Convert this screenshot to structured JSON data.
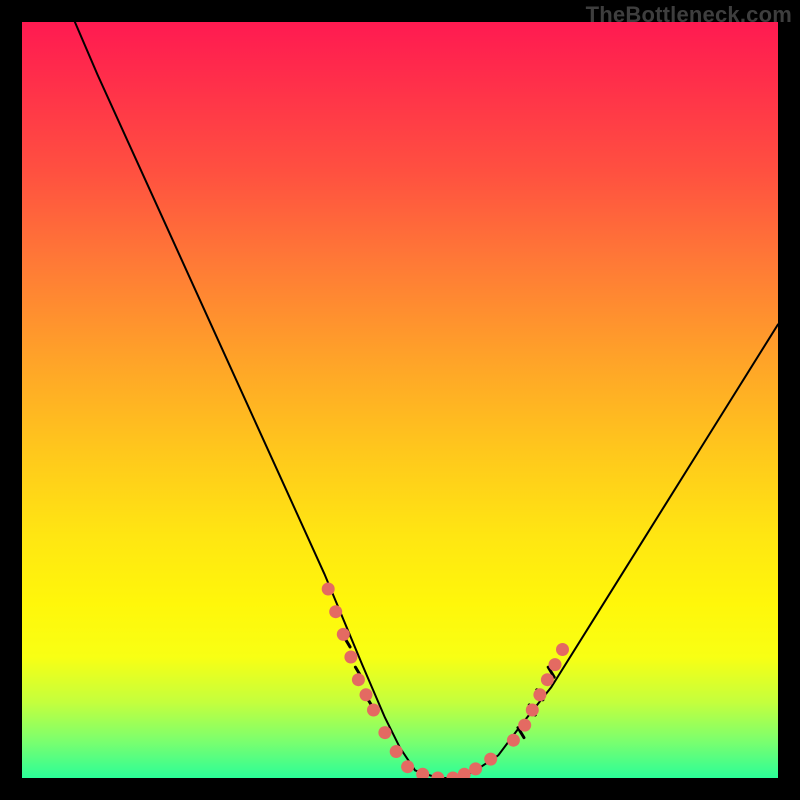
{
  "watermark": "TheBottleneck.com",
  "colors": {
    "dot": "#e46a62",
    "curve": "#000000",
    "gradient_top": "#ff1a51",
    "gradient_bottom": "#2bfd98"
  },
  "chart_data": {
    "type": "line",
    "title": "",
    "xlabel": "",
    "ylabel": "",
    "xlim": [
      0,
      100
    ],
    "ylim": [
      0,
      100
    ],
    "grid": false,
    "series": [
      {
        "name": "bottleneck-curve",
        "x": [
          7,
          10,
          15,
          20,
          25,
          30,
          35,
          40,
          45,
          48,
          50,
          52,
          55,
          58,
          60,
          63,
          66,
          70,
          75,
          80,
          85,
          90,
          95,
          100
        ],
        "y": [
          100,
          93,
          82,
          71,
          60,
          49,
          38,
          27,
          15,
          8,
          4,
          1,
          0,
          0,
          1,
          3,
          7,
          12,
          20,
          28,
          36,
          44,
          52,
          60
        ]
      }
    ],
    "markers": {
      "name": "highlight-dots",
      "note": "approximate salmon-colored data-point markers visible near the curve minimum and on both rising walls",
      "points": [
        {
          "x": 40.5,
          "y": 25
        },
        {
          "x": 41.5,
          "y": 22
        },
        {
          "x": 42.5,
          "y": 19
        },
        {
          "x": 43.5,
          "y": 16
        },
        {
          "x": 44.5,
          "y": 13
        },
        {
          "x": 45.5,
          "y": 11
        },
        {
          "x": 46.5,
          "y": 9
        },
        {
          "x": 48,
          "y": 6
        },
        {
          "x": 49.5,
          "y": 3.5
        },
        {
          "x": 51,
          "y": 1.5
        },
        {
          "x": 53,
          "y": 0.5
        },
        {
          "x": 55,
          "y": 0
        },
        {
          "x": 57,
          "y": 0
        },
        {
          "x": 58.5,
          "y": 0.5
        },
        {
          "x": 60,
          "y": 1.2
        },
        {
          "x": 62,
          "y": 2.5
        },
        {
          "x": 65,
          "y": 5
        },
        {
          "x": 66.5,
          "y": 7
        },
        {
          "x": 67.5,
          "y": 9
        },
        {
          "x": 68.5,
          "y": 11
        },
        {
          "x": 69.5,
          "y": 13
        },
        {
          "x": 70.5,
          "y": 15
        },
        {
          "x": 71.5,
          "y": 17
        }
      ]
    },
    "axis_ticks": {
      "note": "short black tick marks visible along the curve edges",
      "points": [
        {
          "x": 43,
          "y": 18
        },
        {
          "x": 44.5,
          "y": 14
        },
        {
          "x": 46,
          "y": 10
        },
        {
          "x": 66,
          "y": 6
        },
        {
          "x": 67.5,
          "y": 9
        },
        {
          "x": 68.5,
          "y": 11
        },
        {
          "x": 70,
          "y": 14
        }
      ]
    }
  }
}
